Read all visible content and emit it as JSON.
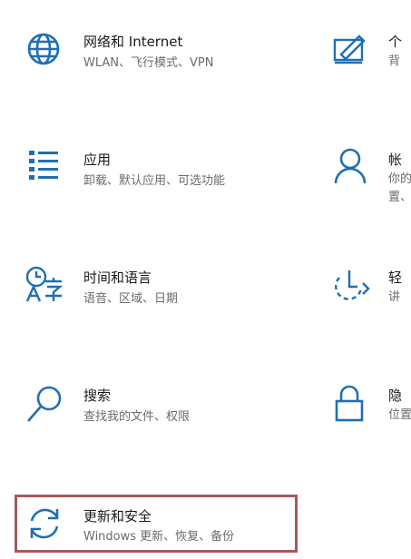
{
  "colors": {
    "icon_blue": "#1f6fb2",
    "highlight_border": "#a65a5a"
  },
  "tiles": [
    {
      "icon": "globe-icon",
      "title": "网络和 Internet",
      "desc": "WLAN、飞行模式、VPN"
    },
    {
      "icon": "apps-list-icon",
      "title": "应用",
      "desc": "卸载、默认应用、可选功能"
    },
    {
      "icon": "time-language-icon",
      "title": "时间和语言",
      "desc": "语音、区域、日期"
    },
    {
      "icon": "search-icon",
      "title": "搜索",
      "desc": "查找我的文件、权限"
    },
    {
      "icon": "update-sync-icon",
      "title": "更新和安全",
      "desc": "Windows 更新、恢复、备份"
    }
  ],
  "right_tiles": [
    {
      "icon": "personalization-icon",
      "title": "个",
      "desc": "背"
    },
    {
      "icon": "account-icon",
      "title": "帐",
      "desc": "你的",
      "desc2": "置、"
    },
    {
      "icon": "ease-of-access-icon",
      "title": "轻",
      "desc": "讲"
    },
    {
      "icon": "privacy-lock-icon",
      "title": "隐",
      "desc": "位置"
    }
  ]
}
